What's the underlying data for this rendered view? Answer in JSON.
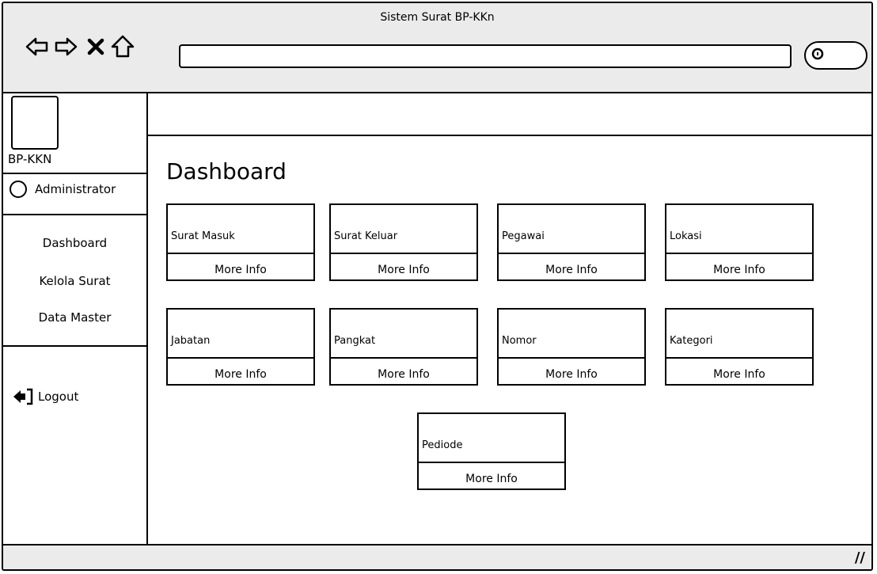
{
  "window": {
    "title": "Sistem Surat BP-KKn"
  },
  "toolbar": {
    "back_icon": "back-arrow-icon",
    "forward_icon": "forward-arrow-icon",
    "close_icon": "x-icon",
    "home_icon": "home-icon",
    "address_value": "",
    "search_icon": "search-icon"
  },
  "sidebar": {
    "brand": "BP-KKN",
    "user": "Administrator",
    "menu": [
      {
        "label": "Dashboard"
      },
      {
        "label": "Kelola Surat"
      },
      {
        "label": "Data Master"
      }
    ],
    "logout": "Logout"
  },
  "main": {
    "title": "Dashboard",
    "cards": [
      {
        "label": "Surat Masuk",
        "more": "More Info"
      },
      {
        "label": "Surat Keluar",
        "more": "More Info"
      },
      {
        "label": "Pegawai",
        "more": "More Info"
      },
      {
        "label": "Lokasi",
        "more": "More Info"
      },
      {
        "label": "Jabatan",
        "more": "More Info"
      },
      {
        "label": "Pangkat",
        "more": "More Info"
      },
      {
        "label": "Nomor",
        "more": "More Info"
      },
      {
        "label": "Kategori",
        "more": "More Info"
      },
      {
        "label": "Pediode",
        "more": "More Info"
      }
    ]
  },
  "statusbar": {
    "grip": "//"
  }
}
